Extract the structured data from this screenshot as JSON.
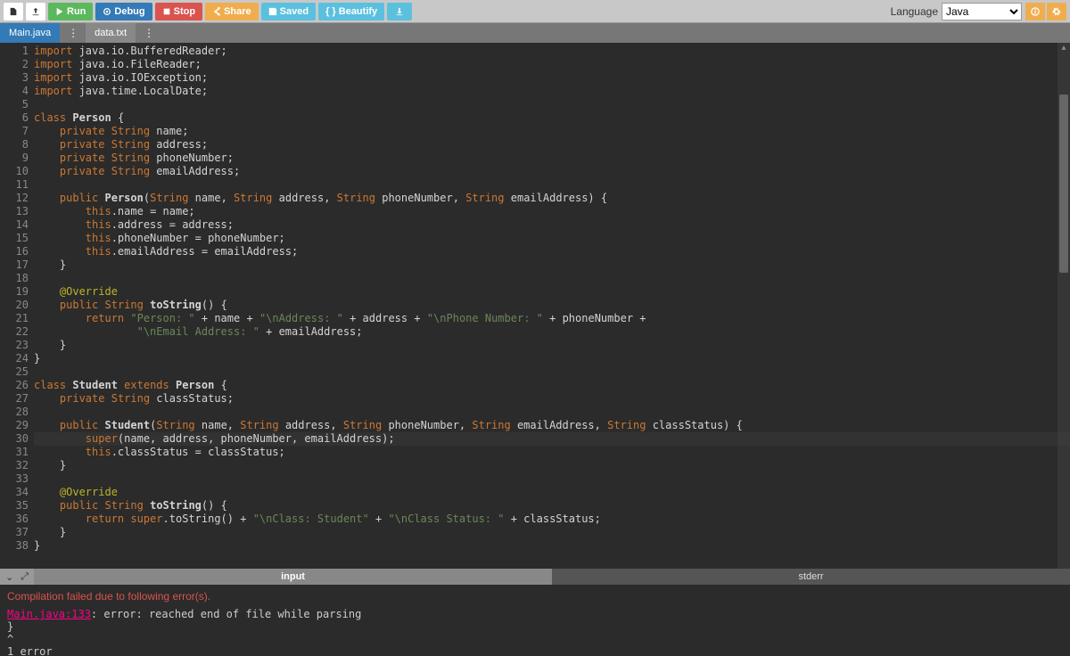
{
  "toolbar": {
    "run": "Run",
    "debug": "Debug",
    "stop": "Stop",
    "share": "Share",
    "saved": "Saved",
    "beautify": "{ } Beautify"
  },
  "language": {
    "label": "Language",
    "value": "Java"
  },
  "tabs": [
    {
      "label": "Main.java",
      "active": true
    },
    {
      "label": "data.txt",
      "active": false
    }
  ],
  "code_lines": [
    [
      [
        "kw",
        "import"
      ],
      [
        "",
        " java.io.BufferedReader;"
      ]
    ],
    [
      [
        "kw",
        "import"
      ],
      [
        "",
        " java.io.FileReader;"
      ]
    ],
    [
      [
        "kw",
        "import"
      ],
      [
        "",
        " java.io.IOException;"
      ]
    ],
    [
      [
        "kw",
        "import"
      ],
      [
        "",
        " java.time.LocalDate;"
      ]
    ],
    [
      [
        "",
        ""
      ]
    ],
    [
      [
        "kw",
        "class"
      ],
      [
        "",
        " "
      ],
      [
        "id",
        "Person"
      ],
      [
        "",
        " {"
      ]
    ],
    [
      [
        "",
        "    "
      ],
      [
        "kw",
        "private"
      ],
      [
        "",
        " "
      ],
      [
        "str-t",
        "String"
      ],
      [
        "",
        " name;"
      ]
    ],
    [
      [
        "",
        "    "
      ],
      [
        "kw",
        "private"
      ],
      [
        "",
        " "
      ],
      [
        "str-t",
        "String"
      ],
      [
        "",
        " address;"
      ]
    ],
    [
      [
        "",
        "    "
      ],
      [
        "kw",
        "private"
      ],
      [
        "",
        " "
      ],
      [
        "str-t",
        "String"
      ],
      [
        "",
        " phoneNumber;"
      ]
    ],
    [
      [
        "",
        "    "
      ],
      [
        "kw",
        "private"
      ],
      [
        "",
        " "
      ],
      [
        "str-t",
        "String"
      ],
      [
        "",
        " emailAddress;"
      ]
    ],
    [
      [
        "",
        ""
      ]
    ],
    [
      [
        "",
        "    "
      ],
      [
        "kw",
        "public"
      ],
      [
        "",
        " "
      ],
      [
        "id",
        "Person"
      ],
      [
        "",
        "("
      ],
      [
        "str-t",
        "String"
      ],
      [
        "",
        " name, "
      ],
      [
        "str-t",
        "String"
      ],
      [
        "",
        " address, "
      ],
      [
        "str-t",
        "String"
      ],
      [
        "",
        " phoneNumber, "
      ],
      [
        "str-t",
        "String"
      ],
      [
        "",
        " emailAddress) {"
      ]
    ],
    [
      [
        "",
        "        "
      ],
      [
        "kw",
        "this"
      ],
      [
        "",
        ".name "
      ],
      [
        "op",
        "="
      ],
      [
        "",
        " name;"
      ]
    ],
    [
      [
        "",
        "        "
      ],
      [
        "kw",
        "this"
      ],
      [
        "",
        ".address "
      ],
      [
        "op",
        "="
      ],
      [
        "",
        " address;"
      ]
    ],
    [
      [
        "",
        "        "
      ],
      [
        "kw",
        "this"
      ],
      [
        "",
        ".phoneNumber "
      ],
      [
        "op",
        "="
      ],
      [
        "",
        " phoneNumber;"
      ]
    ],
    [
      [
        "",
        "        "
      ],
      [
        "kw",
        "this"
      ],
      [
        "",
        ".emailAddress "
      ],
      [
        "op",
        "="
      ],
      [
        "",
        " emailAddress;"
      ]
    ],
    [
      [
        "",
        "    }"
      ]
    ],
    [
      [
        "",
        ""
      ]
    ],
    [
      [
        "",
        "    "
      ],
      [
        "ann",
        "@Override"
      ]
    ],
    [
      [
        "",
        "    "
      ],
      [
        "kw",
        "public"
      ],
      [
        "",
        " "
      ],
      [
        "str-t",
        "String"
      ],
      [
        "",
        " "
      ],
      [
        "id",
        "toString"
      ],
      [
        "",
        "() {"
      ]
    ],
    [
      [
        "",
        "        "
      ],
      [
        "kw",
        "return"
      ],
      [
        "",
        " "
      ],
      [
        "s",
        "\"Person: \""
      ],
      [
        "",
        " "
      ],
      [
        "op",
        "+"
      ],
      [
        "",
        " name "
      ],
      [
        "op",
        "+"
      ],
      [
        "",
        " "
      ],
      [
        "s",
        "\"\\nAddress: \""
      ],
      [
        "",
        " "
      ],
      [
        "op",
        "+"
      ],
      [
        "",
        " address "
      ],
      [
        "op",
        "+"
      ],
      [
        "",
        " "
      ],
      [
        "s",
        "\"\\nPhone Number: \""
      ],
      [
        "",
        " "
      ],
      [
        "op",
        "+"
      ],
      [
        "",
        " phoneNumber "
      ],
      [
        "op",
        "+"
      ]
    ],
    [
      [
        "",
        "                "
      ],
      [
        "s",
        "\"\\nEmail Address: \""
      ],
      [
        "",
        " "
      ],
      [
        "op",
        "+"
      ],
      [
        "",
        " emailAddress;"
      ]
    ],
    [
      [
        "",
        "    }"
      ]
    ],
    [
      [
        "",
        "}"
      ]
    ],
    [
      [
        "",
        ""
      ]
    ],
    [
      [
        "kw",
        "class"
      ],
      [
        "",
        " "
      ],
      [
        "id",
        "Student"
      ],
      [
        "",
        " "
      ],
      [
        "kw",
        "extends"
      ],
      [
        "",
        " "
      ],
      [
        "id",
        "Person"
      ],
      [
        "",
        " {"
      ]
    ],
    [
      [
        "",
        "    "
      ],
      [
        "kw",
        "private"
      ],
      [
        "",
        " "
      ],
      [
        "str-t",
        "String"
      ],
      [
        "",
        " classStatus;"
      ]
    ],
    [
      [
        "",
        ""
      ]
    ],
    [
      [
        "",
        "    "
      ],
      [
        "kw",
        "public"
      ],
      [
        "",
        " "
      ],
      [
        "id",
        "Student"
      ],
      [
        "",
        "("
      ],
      [
        "str-t",
        "String"
      ],
      [
        "",
        " name, "
      ],
      [
        "str-t",
        "String"
      ],
      [
        "",
        " address, "
      ],
      [
        "str-t",
        "String"
      ],
      [
        "",
        " phoneNumber, "
      ],
      [
        "str-t",
        "String"
      ],
      [
        "",
        " emailAddress, "
      ],
      [
        "str-t",
        "String"
      ],
      [
        "",
        " classStatus) {"
      ]
    ],
    [
      [
        "",
        "        "
      ],
      [
        "kw",
        "super"
      ],
      [
        "",
        "(name, address, phoneNumber, emailAddress);"
      ]
    ],
    [
      [
        "",
        "        "
      ],
      [
        "kw",
        "this"
      ],
      [
        "",
        ".classStatus "
      ],
      [
        "op",
        "="
      ],
      [
        "",
        " classStatus;"
      ]
    ],
    [
      [
        "",
        "    }"
      ]
    ],
    [
      [
        "",
        ""
      ]
    ],
    [
      [
        "",
        "    "
      ],
      [
        "ann",
        "@Override"
      ]
    ],
    [
      [
        "",
        "    "
      ],
      [
        "kw",
        "public"
      ],
      [
        "",
        " "
      ],
      [
        "str-t",
        "String"
      ],
      [
        "",
        " "
      ],
      [
        "id",
        "toString"
      ],
      [
        "",
        "() {"
      ]
    ],
    [
      [
        "",
        "        "
      ],
      [
        "kw",
        "return"
      ],
      [
        "",
        " "
      ],
      [
        "kw",
        "super"
      ],
      [
        "",
        ".toString() "
      ],
      [
        "op",
        "+"
      ],
      [
        "",
        " "
      ],
      [
        "s",
        "\"\\nClass: Student\""
      ],
      [
        "",
        " "
      ],
      [
        "op",
        "+"
      ],
      [
        "",
        " "
      ],
      [
        "s",
        "\"\\nClass Status: \""
      ],
      [
        "",
        " "
      ],
      [
        "op",
        "+"
      ],
      [
        "",
        " classStatus;"
      ]
    ],
    [
      [
        "",
        "    }"
      ]
    ],
    [
      [
        "",
        "}"
      ]
    ]
  ],
  "cursor_line": 30,
  "panel": {
    "input_tab": "input",
    "stderr_tab": "stderr",
    "error_header": "Compilation failed due to following error(s).",
    "error_loc": "Main.java:133",
    "error_msg": ": error: reached end of file while parsing",
    "error_brace": "}",
    "error_caret": "^",
    "error_count": "1 error"
  }
}
